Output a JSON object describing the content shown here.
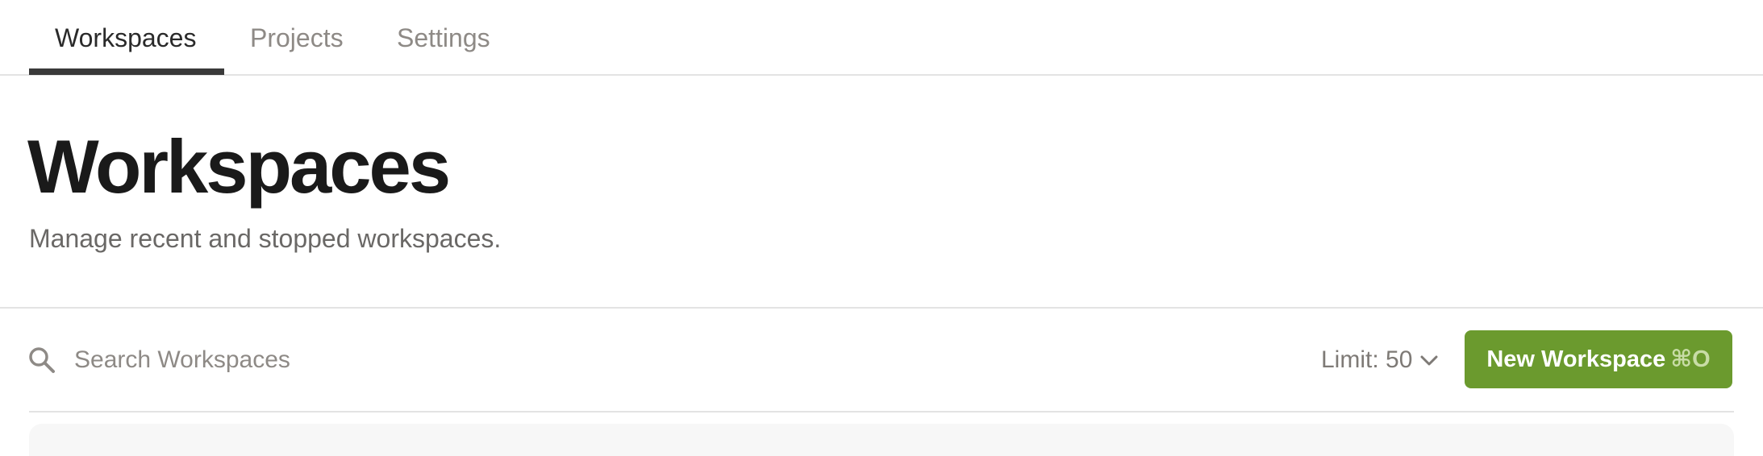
{
  "tabs": [
    {
      "label": "Workspaces",
      "active": true
    },
    {
      "label": "Projects",
      "active": false
    },
    {
      "label": "Settings",
      "active": false
    }
  ],
  "header": {
    "title": "Workspaces",
    "subtitle": "Manage recent and stopped workspaces."
  },
  "toolbar": {
    "search_placeholder": "Search Workspaces",
    "search_value": "",
    "limit_label": "Limit: 50",
    "new_button_label": "New Workspace",
    "new_button_shortcut": "⌘O"
  },
  "icons": {
    "search": "search-icon",
    "limit": "chevron-down-icon"
  },
  "colors": {
    "accent": "#6b9a2e",
    "active_tab_underline": "#3a3a3a",
    "muted_text": "#8e8a86"
  }
}
